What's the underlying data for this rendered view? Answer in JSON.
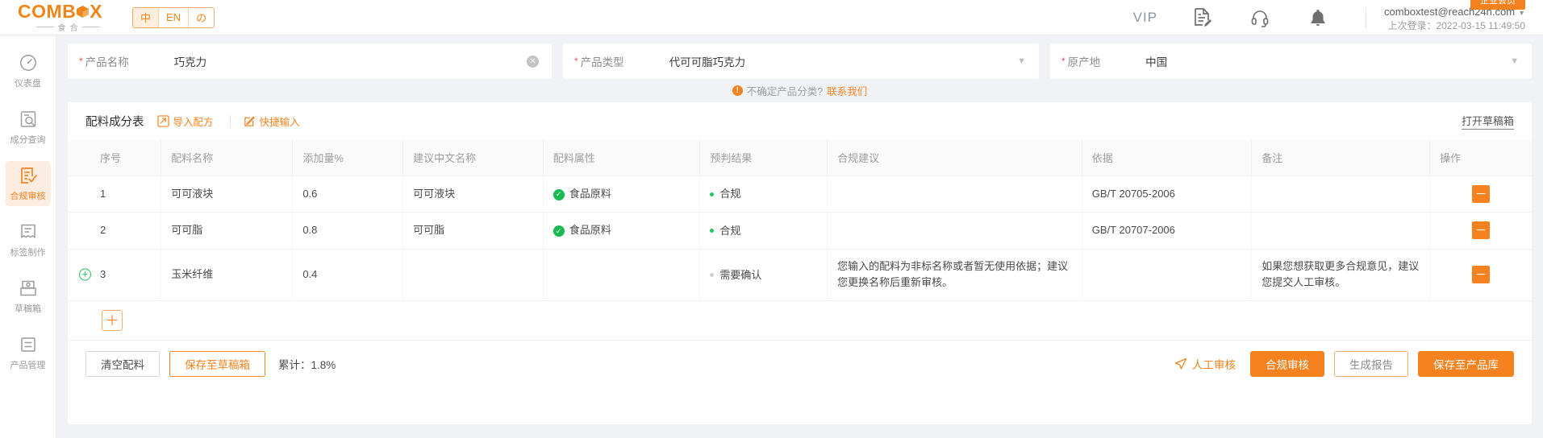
{
  "brand": {
    "name_main": "COMB",
    "name_tail": "X",
    "name_mid": "M",
    "sub_left": "食",
    "sub_right": "合",
    "accent": "#f08519"
  },
  "languages": [
    {
      "label": "中",
      "active": true
    },
    {
      "label": "EN",
      "active": false
    },
    {
      "label": "の",
      "active": false
    }
  ],
  "topbar": {
    "vip_label": "VIP",
    "doc_icon": "document-edit-icon",
    "support_icon": "headset-icon",
    "bell_icon": "bell-icon",
    "badge": "企业会员",
    "email": "comboxtest@reach24h.com",
    "caret": "▼",
    "last_login": "上次登录：2022-03-15 11:49:50"
  },
  "sidebar": {
    "items": [
      {
        "label": "仪表盘",
        "icon": "dashboard-icon",
        "active": false
      },
      {
        "label": "成分查询",
        "icon": "ingredient-search-icon",
        "active": false
      },
      {
        "label": "合规审核",
        "icon": "compliance-review-icon",
        "active": true
      },
      {
        "label": "标签制作",
        "icon": "label-maker-icon",
        "active": false
      },
      {
        "label": "草稿箱",
        "icon": "draft-box-icon",
        "active": false
      },
      {
        "label": "产品管理",
        "icon": "product-management-icon",
        "active": false
      }
    ]
  },
  "form": {
    "product_name": {
      "label": "产品名称",
      "value": "巧克力",
      "required": "*",
      "clear_icon": "clear-circle-icon"
    },
    "product_type": {
      "label": "产品类型",
      "value": "代可可脂巧克力",
      "required": "*",
      "caret": "▼"
    },
    "origin": {
      "label": "原产地",
      "value": "中国",
      "required": "*",
      "caret": "▼"
    }
  },
  "hint": {
    "icon": "info-icon",
    "icon_char": "!",
    "text": "不确定产品分类?",
    "link": "联系我们"
  },
  "panel": {
    "title": "配料成分表",
    "import_label": "导入配方",
    "quick_input_label": "快捷输入",
    "draft_link": "打开草稿箱"
  },
  "table": {
    "headers": [
      "序号",
      "配料名称",
      "添加量%",
      "建议中文名称",
      "配料属性",
      "预判结果",
      "合规建议",
      "依据",
      "备注",
      "操作"
    ],
    "rows": [
      {
        "index": "1",
        "name": "可可液块",
        "amount": "0.6",
        "cn_name": "可可液块",
        "attribute": "食品原料",
        "attribute_state": "ok",
        "prediction": "合规",
        "prediction_state": "green",
        "suggestion": "",
        "basis": "GB/T 20705-2006",
        "note": "",
        "op": "－",
        "has_add_icon": false
      },
      {
        "index": "2",
        "name": "可可脂",
        "amount": "0.8",
        "cn_name": "可可脂",
        "attribute": "食品原料",
        "attribute_state": "ok",
        "prediction": "合规",
        "prediction_state": "green",
        "suggestion": "",
        "basis": "GB/T 20707-2006",
        "note": "",
        "op": "－",
        "has_add_icon": false
      },
      {
        "index": "3",
        "name": "玉米纤维",
        "amount": "0.4",
        "cn_name": "",
        "attribute": "",
        "attribute_state": "none",
        "prediction": "需要确认",
        "prediction_state": "grey",
        "suggestion": "您输入的配料为非标名称或者暂无使用依据；建议您更换名称后重新审核。",
        "basis": "",
        "note": "如果您想获取更多合规意见，建议您提交人工审核。",
        "op": "－",
        "has_add_icon": true
      }
    ],
    "add_row_label": "＋"
  },
  "footer": {
    "clear_label": "清空配料",
    "save_draft_label": "保存至草稿箱",
    "total_label": "累计：1.8%",
    "manual_review_label": "人工审核",
    "manual_review_icon": "send-icon",
    "compliance_review_label": "合规审核",
    "generate_report_label": "生成报告",
    "save_product_label": "保存至产品库"
  }
}
